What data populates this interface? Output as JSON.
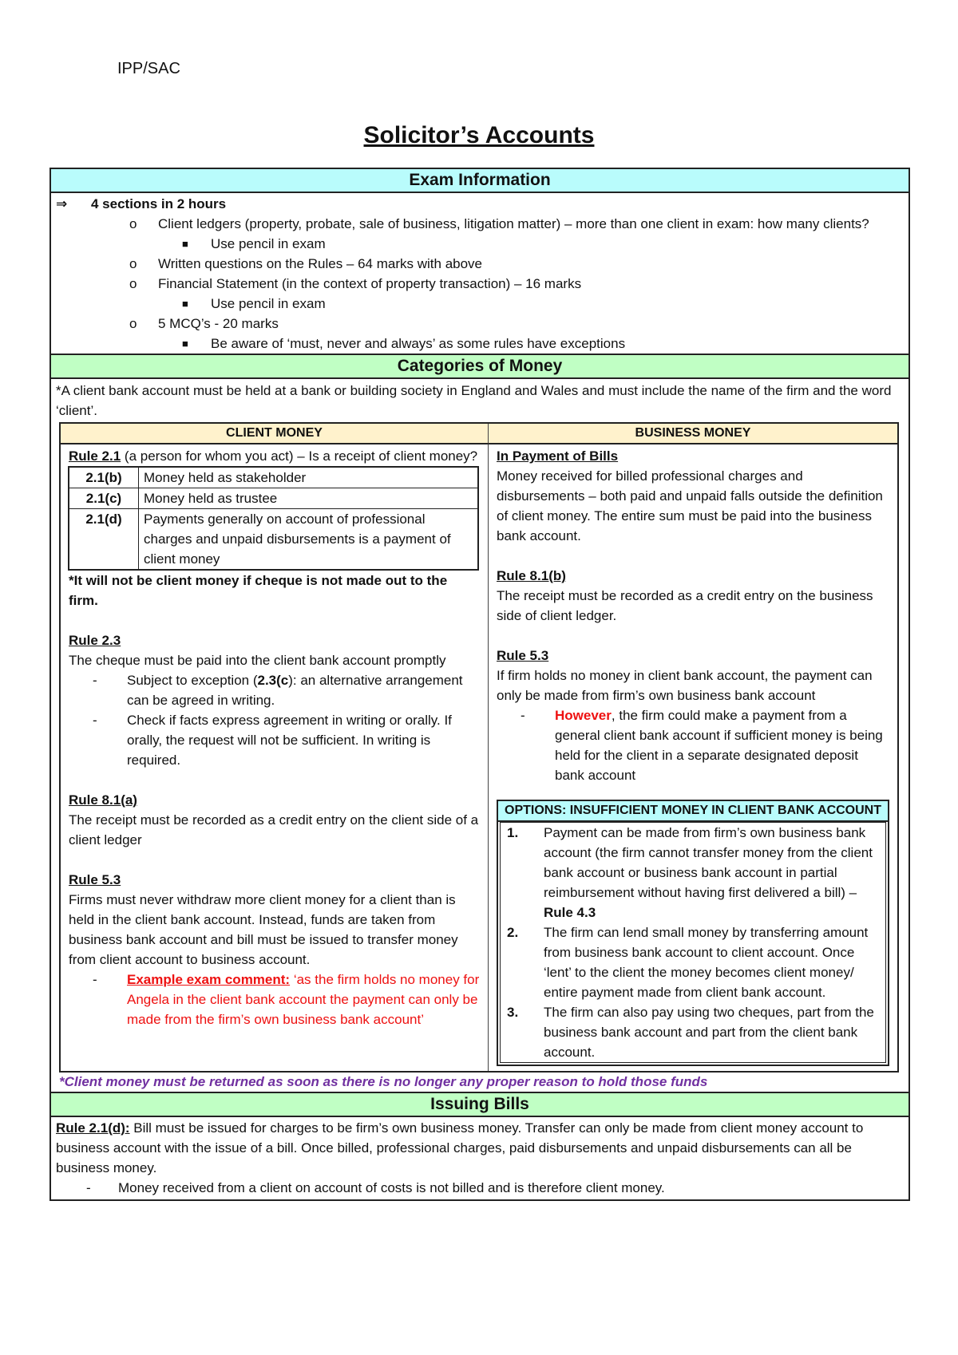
{
  "header": {
    "code": "IPP/SAC"
  },
  "title": "Solicitor’s Accounts",
  "exam_info": {
    "heading": "Exam Information",
    "arrow_icon": "⇒",
    "main_point": "4 sections in 2 hours",
    "items": [
      {
        "text": "Client ledgers (property, probate, sale of business, litigation matter) – more than one client in exam: how many clients?",
        "sub": [
          "Use pencil in exam"
        ]
      },
      {
        "text": "Written questions on the Rules – 64 marks with above",
        "sub": []
      },
      {
        "text": "Financial Statement (in the context of property transaction) – 16 marks",
        "sub": [
          "Use pencil in exam"
        ]
      },
      {
        "text": "5 MCQ’s - 20 marks",
        "sub": [
          "Be aware of ‘must, never and always’ as some rules have exceptions"
        ]
      }
    ]
  },
  "categories": {
    "heading": "Categories of Money",
    "intro": "*A client bank account must be held at a bank or building society in England and Wales and must include the name of the firm and the word ‘client’.",
    "client_money": {
      "heading": "CLIENT MONEY",
      "rule21_title": "Rule 2.1",
      "rule21_text": " (a person for whom you act) – Is a receipt of client money?",
      "subtable": [
        {
          "code": "2.1(b)",
          "desc": "Money held as stakeholder"
        },
        {
          "code": "2.1(c)",
          "desc": "Money held as trustee"
        },
        {
          "code": "2.1(d)",
          "desc": "Payments generally on account of professional charges and unpaid disbursements is a payment of client money"
        }
      ],
      "cheque_note": "*It will not be client money if cheque is not made out to the firm.",
      "rule23_title": "Rule 2.3",
      "rule23_text": "The cheque must be paid into the client bank account promptly",
      "rule23_bullet1_pre": "Subject to exception (",
      "rule23_bullet1_bold": "2.3(c",
      "rule23_bullet1_post": "): an alternative arrangement can be agreed in writing.",
      "rule23_bullet2": "Check if facts express agreement in writing or orally. If orally, the request will not be sufficient. In writing is required.",
      "rule81a_title": "Rule 8.1(a)",
      "rule81a_text": "The receipt must be recorded as a credit entry on the client side of a client ledger",
      "rule53_title": "Rule 5.3",
      "rule53_text": "Firms must never withdraw more client money for a client than is held in the client bank account. Instead, funds are taken from business bank account and bill must be issued to transfer money from client account to business account.",
      "example_label": "Example exam comment:",
      "example_text": " ‘as the firm holds no money for Angela in the client bank account the payment can only be made from the firm’s own business bank account’"
    },
    "business_money": {
      "heading": "BUSINESS MONEY",
      "bills_title": "In Payment of Bills",
      "bills_text": "Money received for billed professional charges and disbursements – both paid and unpaid falls outside the definition of client money. The entire sum must be paid into the business bank account.",
      "rule81b_title": "Rule 8.1(b)",
      "rule81b_text": "The receipt must be recorded as a credit entry on the business side of client ledger.",
      "rule53_title": "Rule 5.3",
      "rule53_text": "If firm holds no money in client bank account, the payment can only be made from firm’s own business bank account",
      "however_label": "However",
      "however_text": ", the firm could make a payment from a general client bank account if sufficient money is being held for the client in a separate designated deposit bank account",
      "options": {
        "heading": "OPTIONS: INSUFFICIENT MONEY IN CLIENT BANK ACCOUNT",
        "items": [
          {
            "num": "1.",
            "text": "Payment can be made from firm’s own business bank account (the firm cannot transfer money from the client bank account or business bank account in partial reimbursement without having first delivered a bill) – ",
            "bold": "Rule 4.3"
          },
          {
            "num": "2.",
            "text": "The firm can lend small money by transferring amount from business bank account to client account. Once ‘lent’ to the client the money becomes client money/ entire payment made from client bank account.",
            "bold": ""
          },
          {
            "num": "3.",
            "text": "The firm can also pay using two cheques, part from the business bank account and part from the client bank account.",
            "bold": ""
          }
        ]
      }
    },
    "return_note": "*Client money must be returned as soon as there is no longer any proper reason to hold those funds"
  },
  "issuing_bills": {
    "heading": "Issuing Bills",
    "rule_title": "Rule 2.1(d):",
    "rule_text": " Bill must be issued for charges to be firm’s own business money. Transfer can only be made from client money account to business account with the issue of a bill. Once billed, professional charges, paid disbursements and unpaid disbursements can all be business money.",
    "bullet": "Money received from a client on account of costs is not billed and is therefore client money."
  },
  "icons": {
    "circle_bullet": "o",
    "square_bullet": "■",
    "dash_bullet": "-"
  },
  "colors": {
    "cyan": "#b9fcfc",
    "green": "#c0ffc4",
    "cream": "#fff2cc",
    "red": "#ee1111",
    "purple": "#7030a0"
  }
}
